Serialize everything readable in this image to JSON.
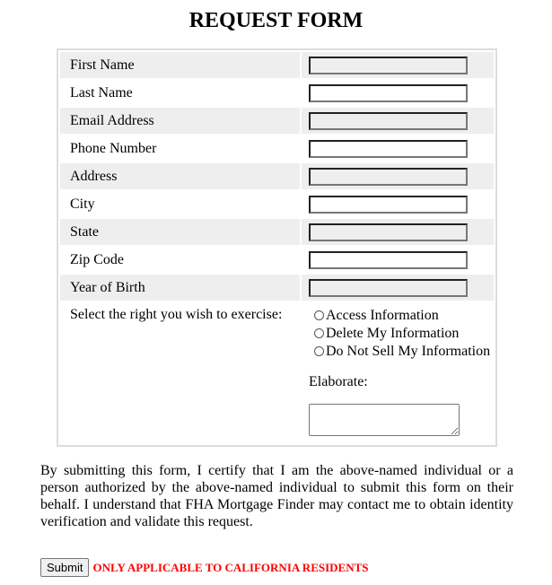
{
  "page": {
    "title": "REQUEST FORM"
  },
  "form": {
    "fields": [
      {
        "label": "First Name",
        "value": "",
        "shaded": true
      },
      {
        "label": "Last Name",
        "value": "",
        "shaded": false
      },
      {
        "label": "Email Address",
        "value": "",
        "shaded": true
      },
      {
        "label": "Phone Number",
        "value": "",
        "shaded": false
      },
      {
        "label": "Address",
        "value": "",
        "shaded": true
      },
      {
        "label": "City",
        "value": "",
        "shaded": false
      },
      {
        "label": "State",
        "value": "",
        "shaded": true
      },
      {
        "label": "Zip Code",
        "value": "",
        "shaded": false
      },
      {
        "label": "Year of Birth",
        "value": "",
        "shaded": true
      }
    ],
    "rights": {
      "label": "Select the right you wish to exercise:",
      "options": [
        {
          "label": "Access Information",
          "checked": false
        },
        {
          "label": "Delete My Information",
          "checked": false
        },
        {
          "label": "Do Not Sell My Information",
          "checked": false
        }
      ]
    },
    "elaborate": {
      "label": "Elaborate:",
      "value": ""
    }
  },
  "disclaimer": "By submitting this form, I certify that I am the above-named individual or a person authorized by the above-named individual to submit this form on their behalf. I understand that FHA Mortgage Finder may contact me to obtain identity verification and validate this request.",
  "submit": {
    "label": "Submit"
  },
  "notice": {
    "text": "ONLY APPLICABLE TO CALIFORNIA RESIDENTS",
    "color": "#ff0000"
  }
}
